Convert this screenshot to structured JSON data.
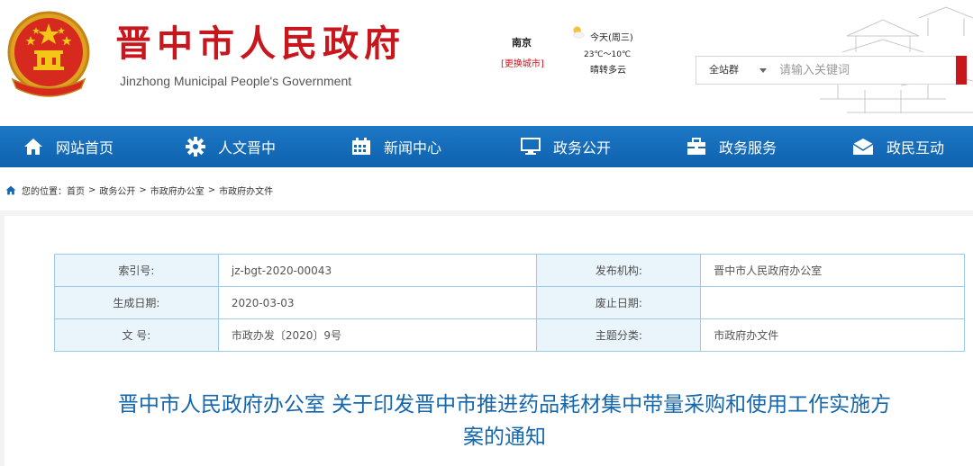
{
  "header": {
    "title": "晋中市人民政府",
    "subtitle": "Jinzhong Municipal People's Government",
    "emblem_icon": "national-emblem-icon",
    "brand_color": "#c8161d"
  },
  "weather": {
    "city": "南京",
    "change_city": "[更换城市]",
    "today": "今天(周三)",
    "temperature": "23℃～10℃",
    "condition": "晴转多云",
    "icon": "sunny-cloud-icon"
  },
  "search": {
    "scope": "全站群",
    "placeholder": "请输入关键词"
  },
  "nav": {
    "background": "#1468b4",
    "items": [
      {
        "label": "网站首页",
        "icon": "home-icon"
      },
      {
        "label": "人文晋中",
        "icon": "gear-icon"
      },
      {
        "label": "新闻中心",
        "icon": "calendar-icon"
      },
      {
        "label": "政务公开",
        "icon": "monitor-icon"
      },
      {
        "label": "政务服务",
        "icon": "briefcase-icon"
      },
      {
        "label": "政民互动",
        "icon": "mail-icon"
      }
    ]
  },
  "breadcrumb": {
    "prefix": "您的位置：",
    "items": [
      "首页",
      "政务公开",
      "市政府办公室",
      "市政府办文件"
    ],
    "separator": ">"
  },
  "info": {
    "rows": [
      {
        "label1": "索引号:",
        "value1": "jz-bgt-2020-00043",
        "label2": "发布机构:",
        "value2": "晋中市人民政府办公室"
      },
      {
        "label1": "生成日期:",
        "value1": "2020-03-03",
        "label2": "废止日期:",
        "value2": ""
      },
      {
        "label1": "文 号:",
        "value1": "市政办发〔2020〕9号",
        "label2": "主题分类:",
        "value2": "市政府办文件"
      }
    ]
  },
  "article": {
    "title_line1": "晋中市人民政府办公室 关于印发晋中市推进药品耗材集中带量采购和使用工作实施方",
    "title_line2": "案的通知"
  }
}
